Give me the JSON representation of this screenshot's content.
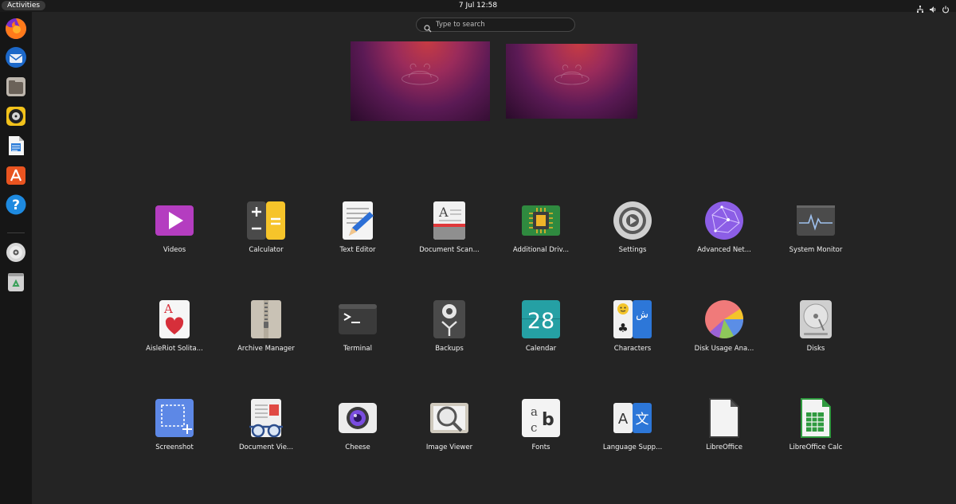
{
  "topbar": {
    "activities_label": "Activities",
    "clock": "7 Jul  12:58",
    "tray_icons": [
      "network-icon",
      "volume-icon",
      "power-icon"
    ]
  },
  "dock": {
    "items": [
      "Firefox",
      "Thunderbird",
      "Files",
      "Rhythmbox",
      "LibreOffice Writer",
      "Ubuntu Software",
      "Help",
      "Disc",
      "Trash"
    ]
  },
  "search": {
    "placeholder": "Type to search"
  },
  "apps": [
    {
      "label": "Videos",
      "icon": "videos-icon"
    },
    {
      "label": "Calculator",
      "icon": "calculator-icon"
    },
    {
      "label": "Text Editor",
      "icon": "text-editor-icon"
    },
    {
      "label": "Document Scan...",
      "icon": "document-scanner-icon"
    },
    {
      "label": "Additional Driv...",
      "icon": "additional-drivers-icon"
    },
    {
      "label": "Settings",
      "icon": "settings-icon"
    },
    {
      "label": "Advanced Net...",
      "icon": "advanced-network-icon"
    },
    {
      "label": "System Monitor",
      "icon": "system-monitor-icon"
    },
    {
      "label": "AisleRiot Solita...",
      "icon": "solitaire-icon"
    },
    {
      "label": "Archive Manager",
      "icon": "archive-manager-icon"
    },
    {
      "label": "Terminal",
      "icon": "terminal-icon"
    },
    {
      "label": "Backups",
      "icon": "backups-icon"
    },
    {
      "label": "Calendar",
      "icon": "calendar-icon",
      "day": "28"
    },
    {
      "label": "Characters",
      "icon": "characters-icon"
    },
    {
      "label": "Disk Usage Ana...",
      "icon": "disk-usage-icon"
    },
    {
      "label": "Disks",
      "icon": "disks-icon"
    },
    {
      "label": "Screenshot",
      "icon": "screenshot-icon"
    },
    {
      "label": "Document Vie...",
      "icon": "document-viewer-icon"
    },
    {
      "label": "Cheese",
      "icon": "cheese-icon"
    },
    {
      "label": "Image Viewer",
      "icon": "image-viewer-icon"
    },
    {
      "label": "Fonts",
      "icon": "fonts-icon"
    },
    {
      "label": "Language Supp...",
      "icon": "language-support-icon"
    },
    {
      "label": "LibreOffice",
      "icon": "libreoffice-icon"
    },
    {
      "label": "LibreOffice Calc",
      "icon": "libreoffice-calc-icon"
    }
  ],
  "colors": {
    "background": "#242424",
    "topbar": "#1a1a1a",
    "dock": "#161616",
    "ubuntu_orange": "#E95420"
  }
}
